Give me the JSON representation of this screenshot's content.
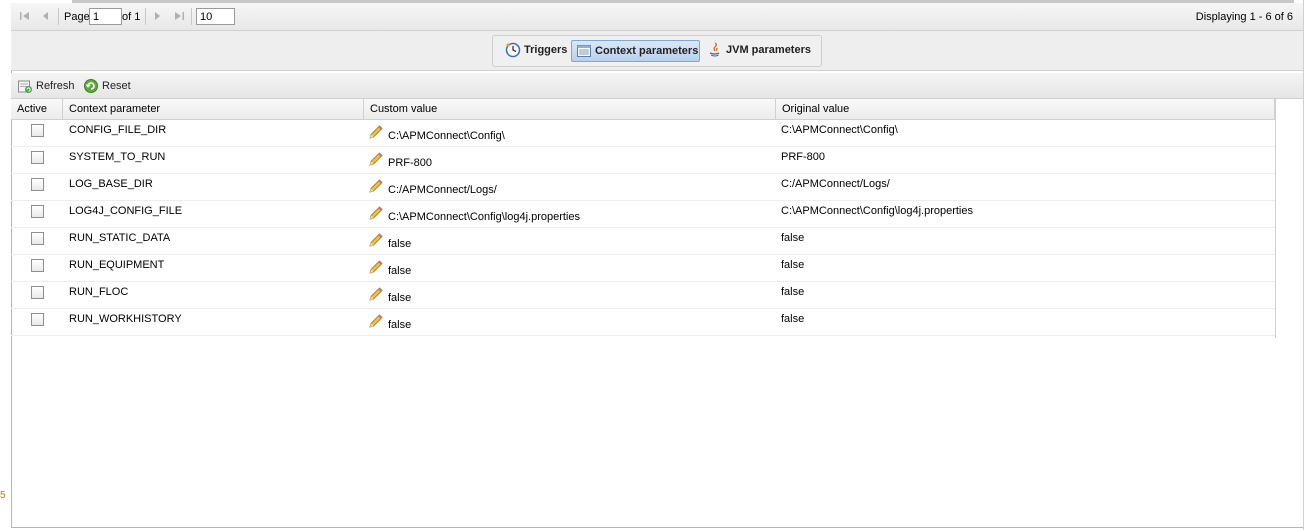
{
  "pager": {
    "page_label": "Page",
    "page_value": "1",
    "of_label": "of 1",
    "page_size": "10",
    "display_text": "Displaying 1 - 6 of 6"
  },
  "tabs": [
    {
      "label": "Triggers",
      "icon": "clock-icon",
      "active": false
    },
    {
      "label": "Context parameters",
      "icon": "table-list-icon",
      "active": true
    },
    {
      "label": "JVM parameters",
      "icon": "java-icon",
      "active": false
    }
  ],
  "toolbar": {
    "refresh_label": "Refresh",
    "reset_label": "Reset"
  },
  "grid": {
    "columns": [
      "Active",
      "Context parameter",
      "Custom value",
      "Original value"
    ],
    "rows": [
      {
        "active": false,
        "parameter": "CONFIG_FILE_DIR",
        "custom": "C:\\APMConnect\\Config\\",
        "original": "C:\\APMConnect\\Config\\"
      },
      {
        "active": false,
        "parameter": "SYSTEM_TO_RUN",
        "custom": "PRF-800",
        "original": "PRF-800"
      },
      {
        "active": false,
        "parameter": "LOG_BASE_DIR",
        "custom": "C:/APMConnect/Logs/",
        "original": "C:/APMConnect/Logs/"
      },
      {
        "active": false,
        "parameter": "LOG4J_CONFIG_FILE",
        "custom": "C:\\APMConnect\\Config\\log4j.properties",
        "original": "C:\\APMConnect\\Config\\log4j.properties"
      },
      {
        "active": false,
        "parameter": "RUN_STATIC_DATA",
        "custom": "false",
        "original": "false"
      },
      {
        "active": false,
        "parameter": "RUN_EQUIPMENT",
        "custom": "false",
        "original": "false"
      },
      {
        "active": false,
        "parameter": "RUN_FLOC",
        "custom": "false",
        "original": "false"
      },
      {
        "active": false,
        "parameter": "RUN_WORKHISTORY",
        "custom": "false",
        "original": "false"
      }
    ]
  },
  "colors": {
    "accent_border": "#99bbe8",
    "active_tab_bg": "#b8d0ee"
  }
}
